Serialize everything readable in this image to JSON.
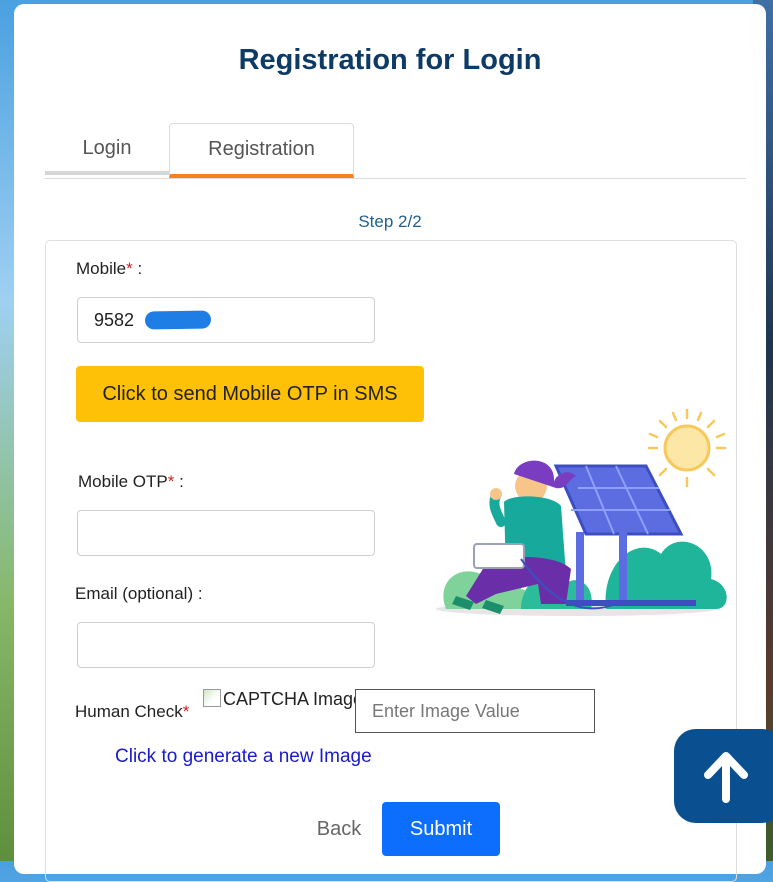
{
  "page": {
    "title": "Registration for Login"
  },
  "tabs": [
    {
      "label": "Login",
      "active": false
    },
    {
      "label": "Registration",
      "active": true
    }
  ],
  "step": "Step 2/2",
  "form": {
    "mobile": {
      "label": "Mobile",
      "required_mark": "*",
      "colon": " :",
      "value_visible": "9582"
    },
    "send_otp_button": "Click to send Mobile OTP in SMS",
    "mobile_otp": {
      "label": "Mobile OTP",
      "required_mark": "*",
      "colon": " :",
      "value": ""
    },
    "email": {
      "label": "Email (optional) :",
      "value": ""
    },
    "human_check": {
      "label": "Human Check",
      "required_mark": "*",
      "captcha_alt": "CAPTCHA Image",
      "placeholder": "Enter Image Value"
    },
    "regenerate_link": "Click to generate a new Image",
    "back_button": "Back",
    "submit_button": "Submit"
  },
  "colors": {
    "title": "#0d3b66",
    "active_tab_underline": "#f5821f",
    "otp_button": "#ffc107",
    "submit_button": "#0d6efd",
    "scroll_top_button": "#0a4f8f"
  },
  "icons": {
    "scroll_top": "arrow-up-icon",
    "illustration": "solar-panel-illustration"
  }
}
